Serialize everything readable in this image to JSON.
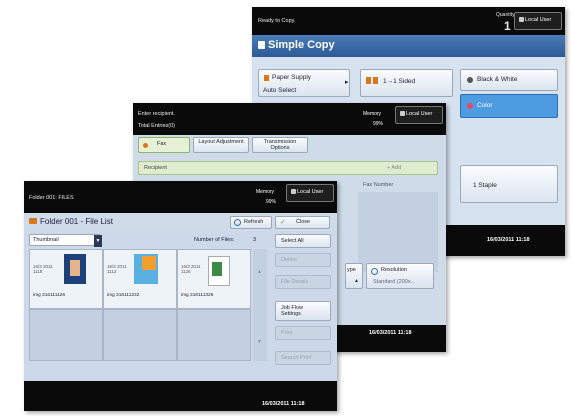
{
  "screen3": {
    "status": "Ready to Copy.",
    "quantity_label": "Quantity",
    "quantity_value": "1",
    "local_user": "Local User",
    "title": "Simple Copy",
    "paper_supply": "Paper Supply",
    "auto_select": "Auto Select",
    "sided": "1→1 Sided",
    "black_white": "Black & White",
    "color": "Color",
    "staple": "1 Staple",
    "date": "16/03/2011 11:18"
  },
  "screen2": {
    "status": "Enter recipient.",
    "total_entries": "Total Entries(0)",
    "memory_label": "Memory",
    "memory_value": "99%",
    "local_user": "Local User",
    "tabs": [
      "Fax",
      "Layout Adjustment",
      "Transmission Options"
    ],
    "recipient_label": "Recipient",
    "add_label": "+ Add",
    "fax_number_label": "Fax Number",
    "resolution_label": "Resolution",
    "resolution_value": "Standard (200x...",
    "type_label": "ype",
    "date": "16/03/2011 11:18"
  },
  "screen1": {
    "path": "Folder 001: FILES",
    "memory_label": "Memory",
    "memory_value": "99%",
    "local_user": "Local User",
    "title": "Folder 001 - File List",
    "refresh": "Refresh",
    "close": "Close",
    "view_mode": "Thumbnail",
    "number_of_files_label": "Number of Files:",
    "number_of_files_value": "3",
    "select_all": "Select All",
    "delete": "Delete",
    "file_details": "File Details",
    "job_flow": "Job Flow Settings",
    "print": "Print",
    "search_print": "Search Print",
    "files": [
      {
        "date": "16/3 2011 1118",
        "name": "img 316111126"
      },
      {
        "date": "16/3 2011 1112",
        "name": "img 316111232"
      },
      {
        "date": "16/3 2011 1126",
        "name": "img 316111326"
      }
    ],
    "date": "16/03/2011 11:18"
  },
  "colors": {
    "accent_orange": "#d9781a",
    "selection_blue": "#4d9be0",
    "panel_blue": "#cdd9e8"
  }
}
